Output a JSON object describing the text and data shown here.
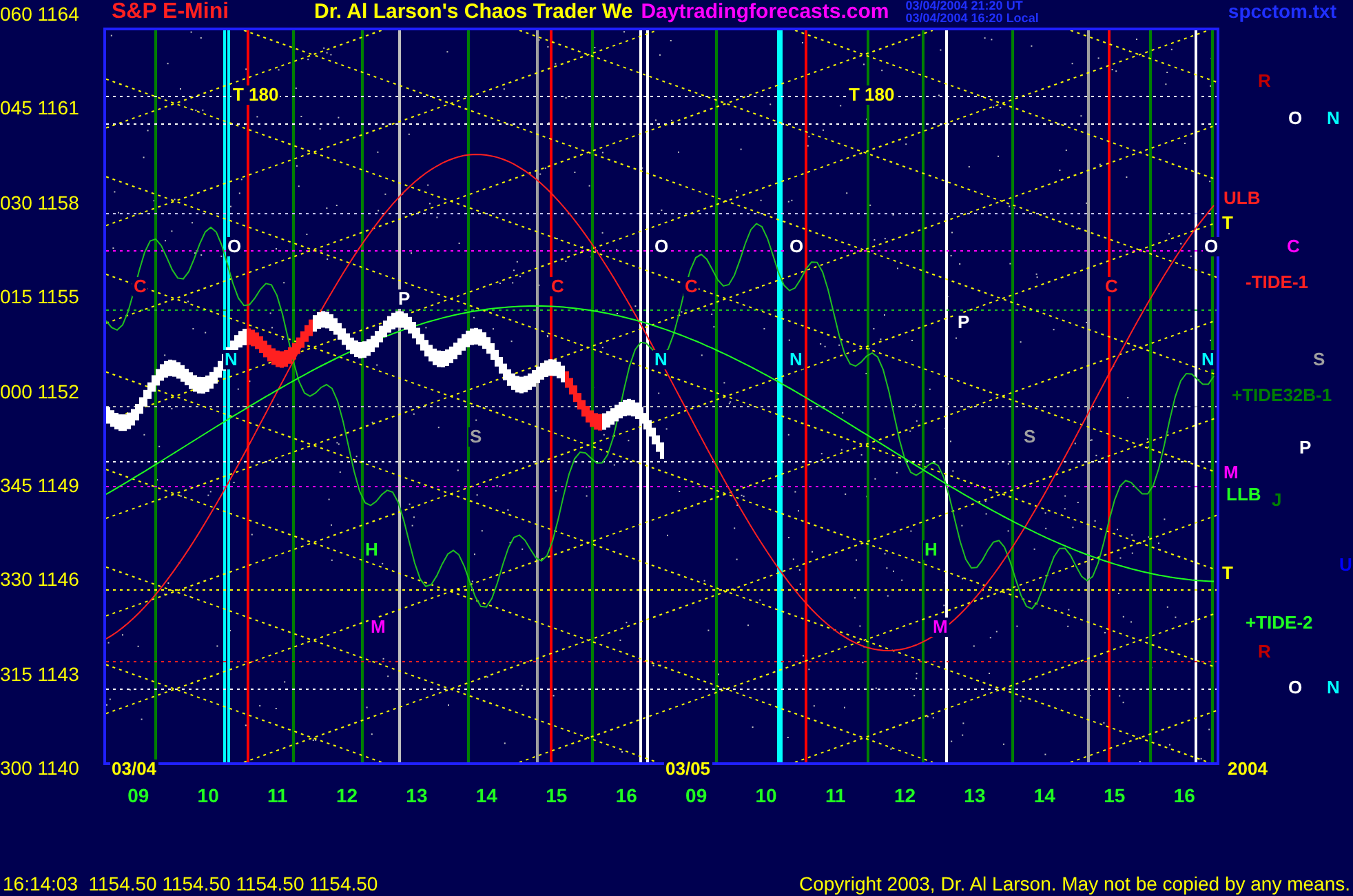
{
  "header": {
    "symbol": "S&P E-Mini",
    "title": "Dr. Al Larson's Chaos Trader We",
    "site": "Daytradingforecasts.com",
    "timestamps": [
      "03/04/2004 21:20 UT",
      "03/04/2004 16:20 Local"
    ],
    "file": "spcctom.txt"
  },
  "y_axis": [
    {
      "angle": "060",
      "price": "1164"
    },
    {
      "angle": "045",
      "price": "1161"
    },
    {
      "angle": "030",
      "price": "1158"
    },
    {
      "angle": "015",
      "price": "1155"
    },
    {
      "angle": "000",
      "price": "1152"
    },
    {
      "angle": "345",
      "price": "1149"
    },
    {
      "angle": "330",
      "price": "1146"
    },
    {
      "angle": "315",
      "price": "1143"
    },
    {
      "angle": "300",
      "price": "1140"
    }
  ],
  "x_axis": [
    "09",
    "10",
    "11",
    "12",
    "13",
    "14",
    "15",
    "16",
    "09",
    "10",
    "11",
    "12",
    "13",
    "14",
    "15",
    "16"
  ],
  "chart_labels": [
    {
      "text": "T 180",
      "color": "#ffff00"
    },
    {
      "text": "T 180",
      "color": "#ffff00"
    },
    {
      "text": "O",
      "color": "#ffffff"
    },
    {
      "text": "O",
      "color": "#ffffff"
    },
    {
      "text": "O",
      "color": "#ffffff"
    },
    {
      "text": "O",
      "color": "#ffffff"
    },
    {
      "text": "C",
      "color": "#ff2020"
    },
    {
      "text": "C",
      "color": "#ff2020"
    },
    {
      "text": "C",
      "color": "#ff2020"
    },
    {
      "text": "C",
      "color": "#ff2020"
    },
    {
      "text": "N",
      "color": "#00ffff"
    },
    {
      "text": "N",
      "color": "#00ffff"
    },
    {
      "text": "N",
      "color": "#00ffff"
    },
    {
      "text": "N",
      "color": "#00ffff"
    },
    {
      "text": "P",
      "color": "#ffffff"
    },
    {
      "text": "P",
      "color": "#ffffff"
    },
    {
      "text": "S",
      "color": "#a0a0a0"
    },
    {
      "text": "S",
      "color": "#a0a0a0"
    },
    {
      "text": "H",
      "color": "#20ff20"
    },
    {
      "text": "H",
      "color": "#20ff20"
    },
    {
      "text": "M",
      "color": "#ff00ff"
    },
    {
      "text": "M",
      "color": "#ff00ff"
    },
    {
      "text": "03/04",
      "color": "#ffff00"
    },
    {
      "text": "03/05",
      "color": "#ffff00"
    },
    {
      "text": "2004",
      "color": "#ffff00"
    }
  ],
  "side_labels": [
    {
      "text": "R",
      "color": "#c00000"
    },
    {
      "text": "O",
      "color": "#ffffff"
    },
    {
      "text": "N",
      "color": "#00ffff"
    },
    {
      "text": "ULB",
      "color": "#ff2020"
    },
    {
      "text": "T",
      "color": "#ffff00"
    },
    {
      "text": "C",
      "color": "#ff00ff"
    },
    {
      "text": "-TIDE-1",
      "color": "#ff2020"
    },
    {
      "text": "S",
      "color": "#a0a0a0"
    },
    {
      "text": "+TIDE32B-1",
      "color": "#008000"
    },
    {
      "text": "P",
      "color": "#ffffff"
    },
    {
      "text": "M",
      "color": "#ff00ff"
    },
    {
      "text": "LLB",
      "color": "#20ff20"
    },
    {
      "text": "J",
      "color": "#008000"
    },
    {
      "text": "T",
      "color": "#ffff00"
    },
    {
      "text": "U",
      "color": "#0000ff"
    },
    {
      "text": "+TIDE-2",
      "color": "#20ff20"
    },
    {
      "text": "R",
      "color": "#c00000"
    },
    {
      "text": "O",
      "color": "#ffffff"
    },
    {
      "text": "N",
      "color": "#00ffff"
    }
  ],
  "footer": {
    "quote": "16:14:03  1154.50 1154.50 1154.50 1154.50",
    "copyright": "Copyright 2003, Dr. Al Larson. May not be copied by any means."
  }
}
